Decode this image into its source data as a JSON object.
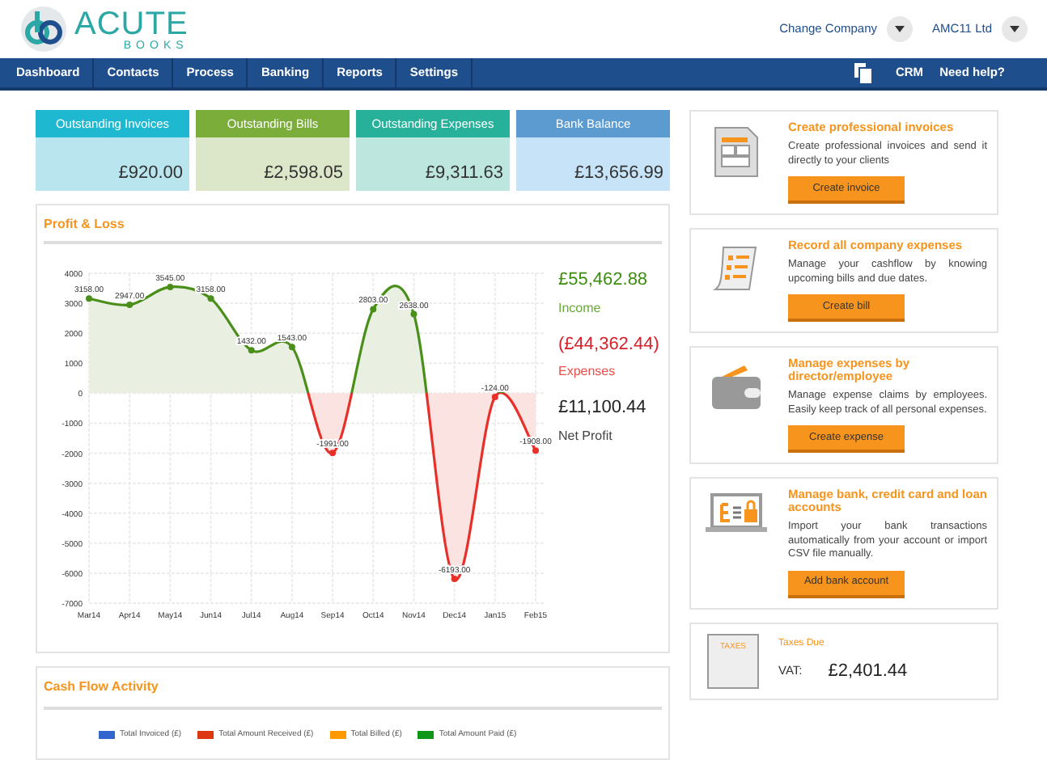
{
  "header": {
    "logo": {
      "name": "ACUTE",
      "sub": "BOOKS"
    },
    "company_switch": "Change Company",
    "company": "AMC11 Ltd"
  },
  "nav": {
    "items": [
      "Dashboard",
      "Contacts",
      "Process",
      "Banking",
      "Reports",
      "Settings"
    ],
    "right": [
      "CRM",
      "Need help?"
    ]
  },
  "summary_cards": [
    {
      "title": "Outstanding Invoices",
      "value": "£920.00",
      "color": "#1fb8d1"
    },
    {
      "title": "Outstanding Bills",
      "value": "£2,598.05",
      "color": "#7aad3a"
    },
    {
      "title": "Outstanding Expenses",
      "value": "£9,311.63",
      "color": "#27b09a"
    },
    {
      "title": "Bank Balance",
      "value": "£13,656.99",
      "color": "#5b9bd0"
    }
  ],
  "profit_loss": {
    "title": "Profit & Loss",
    "chart_data": {
      "type": "area",
      "categories": [
        "Mar14",
        "Apr14",
        "May14",
        "Jun14",
        "Jul14",
        "Aug14",
        "Sep14",
        "Oct14",
        "Nov14",
        "Dec14",
        "Jan15",
        "Feb15"
      ],
      "series": [
        {
          "color": "#4a8f1a",
          "values": [
            3158,
            2947,
            3545,
            3158,
            1432,
            1543,
            -1991,
            2803,
            2638,
            -6193,
            -124,
            -1908
          ]
        }
      ],
      "ylim": [
        -7000,
        4000
      ],
      "yticks": [
        4000,
        3000,
        2000,
        1000,
        0,
        -1000,
        -2000,
        -3000,
        -4000,
        -5000,
        -6000,
        -7000
      ],
      "grid": true,
      "value_labels": [
        "3158.00",
        "2947.00",
        "3545.00",
        "3158.00",
        "1432.00",
        "1543.00",
        "-1991.00",
        "2803.00",
        "2638.00",
        "-6193.00",
        "-124.00",
        "-1908.00"
      ]
    },
    "stats": [
      {
        "kind": "income",
        "value": "£55,462.88",
        "label": "Income"
      },
      {
        "kind": "expense",
        "value": "(£44,362.44)",
        "label": "Expenses"
      },
      {
        "kind": "net",
        "value": "£11,100.44",
        "label": "Net Profit"
      }
    ]
  },
  "cash_flow": {
    "title": "Cash Flow Activity",
    "legend": [
      {
        "label": "Total Invoiced (£)",
        "color": "#3366cc"
      },
      {
        "label": "Total Amount Received (£)",
        "color": "#dc3912"
      },
      {
        "label": "Total Billed (£)",
        "color": "#ff9900"
      },
      {
        "label": "Total Amount Paid (£)",
        "color": "#109618"
      }
    ]
  },
  "promos": [
    {
      "kind": "invoice",
      "title": "Create professional invoices",
      "text": "Create professional invoices and send it directly to your clients",
      "button": "Create invoice"
    },
    {
      "kind": "bill",
      "title": "Record all company expenses",
      "text": "Manage your cashflow by knowing upcoming bills and due dates.",
      "button": "Create bill"
    },
    {
      "kind": "wallet",
      "title": "Manage expenses by director/employee",
      "text": "Manage expense claims by employees. Easily keep track of all personal expenses.",
      "button": "Create expense"
    },
    {
      "kind": "bank",
      "title": "Manage bank, credit card and loan accounts",
      "text": "Import your bank transactions automatically from your account or import CSV file manually.",
      "button": "Add bank account"
    }
  ],
  "taxes": {
    "title": "Taxes Due",
    "label": "VAT:",
    "value": "£2,401.44",
    "icon_text": "TAXES"
  }
}
